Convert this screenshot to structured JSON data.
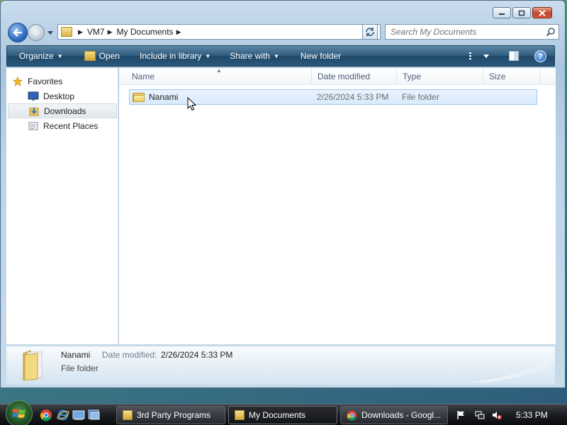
{
  "window": {
    "caption_buttons": [
      "minimize",
      "maximize",
      "close"
    ]
  },
  "nav": {
    "back_icon": "back-arrow-icon",
    "forward_icon": "forward-arrow-icon",
    "breadcrumbs": [
      "VM7",
      "My Documents"
    ],
    "search_placeholder": "Search My Documents"
  },
  "toolbar": {
    "organize": "Organize",
    "open": "Open",
    "include_in_library": "Include in library",
    "share_with": "Share with",
    "new_folder": "New folder"
  },
  "sidebar": {
    "items": [
      {
        "label": "Favorites",
        "icon": "star-icon"
      },
      {
        "label": "Desktop",
        "icon": "desktop-icon"
      },
      {
        "label": "Downloads",
        "icon": "downloads-icon",
        "selected": true
      },
      {
        "label": "Recent Places",
        "icon": "recent-places-icon"
      }
    ]
  },
  "columns": {
    "name": "Name",
    "date_modified": "Date modified",
    "type": "Type",
    "size": "Size"
  },
  "files": [
    {
      "name": "Nanami",
      "date_modified": "2/26/2024 5:33 PM",
      "type": "File folder",
      "size": ""
    }
  ],
  "details": {
    "name": "Nanami",
    "date_label": "Date modified:",
    "date_value": "2/26/2024 5:33 PM",
    "type": "File folder"
  },
  "taskbar": {
    "buttons": [
      {
        "label": "3rd Party Programs",
        "icon": "folder-icon"
      },
      {
        "label": "My Documents",
        "icon": "folder-icon",
        "active": true
      },
      {
        "label": "Downloads - Googl...",
        "icon": "chrome-icon"
      }
    ],
    "clock": "5:33 PM"
  },
  "colors": {
    "accent": "#2f5b7e",
    "selection": "#d8eafb",
    "selection_border": "#99c7ee"
  }
}
